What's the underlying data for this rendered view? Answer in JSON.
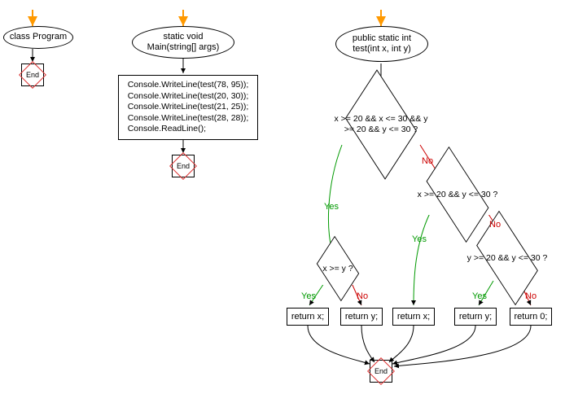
{
  "flowchart": {
    "nodes": {
      "class_program": "class Program",
      "main_signature": "static void\nMain(string[] args)",
      "main_body": "Console.WriteLine(test(78, 95));\nConsole.WriteLine(test(20, 30));\nConsole.WriteLine(test(21, 25));\nConsole.WriteLine(test(28, 28));\nConsole.ReadLine();",
      "test_signature": "public static int\ntest(int x, int y)",
      "end_label": "End",
      "decision1": "x >= 20 && x <= 30 && y\n>= 20 && y <= 30 ?",
      "decision2": "x >= 20 && y <= 30 ?",
      "decision3": "x >= y ?",
      "decision4": "y >= 20 && y <= 30 ?",
      "return_x": "return x;",
      "return_y": "return y;",
      "return_0": "return 0;"
    },
    "edge_labels": {
      "yes": "Yes",
      "no": "No"
    }
  }
}
